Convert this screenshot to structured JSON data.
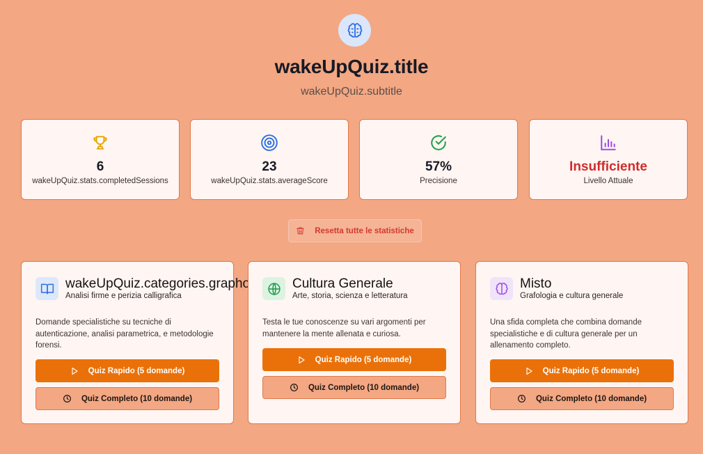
{
  "header": {
    "icon": "brain-icon",
    "title": "wakeUpQuiz.title",
    "subtitle": "wakeUpQuiz.subtitle"
  },
  "stats": [
    {
      "icon": "trophy-icon",
      "value": "6",
      "label": "wakeUpQuiz.stats.completedSessions",
      "color": "#e5a700"
    },
    {
      "icon": "target-icon",
      "value": "23",
      "label": "wakeUpQuiz.stats.averageScore",
      "color": "#2f6fe0"
    },
    {
      "icon": "check-circle-icon",
      "value": "57%",
      "label": "Precisione",
      "color": "#22a14a"
    },
    {
      "icon": "bar-chart-icon",
      "value": "Insufficiente",
      "label": "Livello Attuale",
      "color": "#9b4de6",
      "value_color": "#d02c2c"
    }
  ],
  "reset": {
    "icon": "trash-icon",
    "label": "Resetta tutte le statistiche"
  },
  "categories": [
    {
      "icon": "book-icon",
      "icon_color": "#2f6fe0",
      "icon_bg": "#dde8fb",
      "title": "wakeUpQuiz.categories.graphology",
      "subtitle": "Analisi firme e perizia calligrafica",
      "description": "Domande specialistiche su tecniche di autenticazione, analisi parametrica, e metodologie forensi.",
      "quick_label": "Quiz Rapido (5 domande)",
      "full_label": "Quiz Completo (10 domande)"
    },
    {
      "icon": "globe-icon",
      "icon_color": "#1f9a4a",
      "icon_bg": "#dcf3e2",
      "title": "Cultura Generale",
      "subtitle": "Arte, storia, scienza e letteratura",
      "description": "Testa le tue conoscenze su vari argomenti per mantenere la mente allenata e curiosa.",
      "quick_label": "Quiz Rapido (5 domande)",
      "full_label": "Quiz Completo (10 domande)"
    },
    {
      "icon": "brain-icon",
      "icon_color": "#9b4de6",
      "icon_bg": "#f0e4fb",
      "title": "Misto",
      "subtitle": "Grafologia e cultura generale",
      "description": "Una sfida completa che combina domande specialistiche e di cultura generale per un allenamento completo.",
      "quick_label": "Quiz Rapido (5 domande)",
      "full_label": "Quiz Completo (10 domande)"
    }
  ],
  "colors": {
    "background": "#f3a783",
    "accent": "#ea7109",
    "card": "#fff6f3",
    "border": "#e07a4c"
  }
}
